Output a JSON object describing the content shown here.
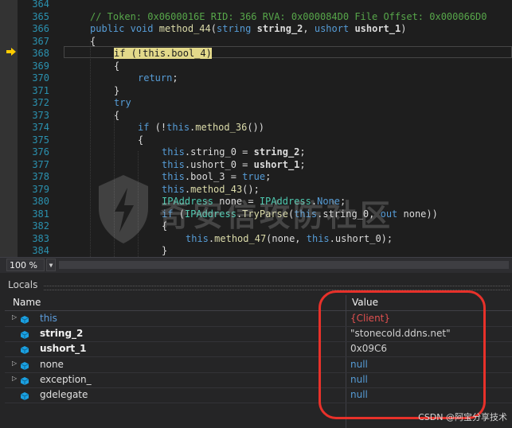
{
  "editor": {
    "lines": [
      {
        "n": "364",
        "parts": []
      },
      {
        "n": "365",
        "parts": [
          {
            "c": "cm",
            "t": "// Token: 0x0600016E RID: 366 RVA: 0x000084D0 File Offset: 0x000066D0"
          }
        ],
        "indent": 0
      },
      {
        "n": "366",
        "parts": [
          {
            "c": "kw",
            "t": "public"
          },
          {
            "c": "pl",
            "t": " "
          },
          {
            "c": "kw",
            "t": "void"
          },
          {
            "c": "pl",
            "t": " "
          },
          {
            "c": "fn",
            "t": "method_44"
          },
          {
            "c": "pl",
            "t": "("
          },
          {
            "c": "kw",
            "t": "string"
          },
          {
            "c": "pl",
            "t": " "
          },
          {
            "c": "bd",
            "t": "string_2"
          },
          {
            "c": "pl",
            "t": ", "
          },
          {
            "c": "kw",
            "t": "ushort"
          },
          {
            "c": "pl",
            "t": " "
          },
          {
            "c": "bd",
            "t": "ushort_1"
          },
          {
            "c": "pl",
            "t": ")"
          }
        ],
        "indent": 0
      },
      {
        "n": "367",
        "parts": [
          {
            "c": "pl",
            "t": "{"
          }
        ],
        "indent": 0
      },
      {
        "n": "368",
        "parts": [
          {
            "c": "kw hl",
            "t": "if"
          },
          {
            "c": "pl hl",
            "t": " (!"
          },
          {
            "c": "kw hl",
            "t": "this"
          },
          {
            "c": "pl hl",
            "t": ".bool_4)"
          }
        ],
        "indent": 1
      },
      {
        "n": "369",
        "parts": [
          {
            "c": "pl",
            "t": "{"
          }
        ],
        "indent": 1
      },
      {
        "n": "370",
        "parts": [
          {
            "c": "kw",
            "t": "return"
          },
          {
            "c": "pl",
            "t": ";"
          }
        ],
        "indent": 2
      },
      {
        "n": "371",
        "parts": [
          {
            "c": "pl",
            "t": "}"
          }
        ],
        "indent": 1
      },
      {
        "n": "372",
        "parts": [
          {
            "c": "kw",
            "t": "try"
          }
        ],
        "indent": 1
      },
      {
        "n": "373",
        "parts": [
          {
            "c": "pl",
            "t": "{"
          }
        ],
        "indent": 1
      },
      {
        "n": "374",
        "parts": [
          {
            "c": "kw",
            "t": "if"
          },
          {
            "c": "pl",
            "t": " (!"
          },
          {
            "c": "kw",
            "t": "this"
          },
          {
            "c": "pl",
            "t": "."
          },
          {
            "c": "fn",
            "t": "method_36"
          },
          {
            "c": "pl",
            "t": "())"
          }
        ],
        "indent": 2
      },
      {
        "n": "375",
        "parts": [
          {
            "c": "pl",
            "t": "{"
          }
        ],
        "indent": 2
      },
      {
        "n": "376",
        "parts": [
          {
            "c": "kw",
            "t": "this"
          },
          {
            "c": "pl",
            "t": ".string_0 = "
          },
          {
            "c": "bd",
            "t": "string_2"
          },
          {
            "c": "pl",
            "t": ";"
          }
        ],
        "indent": 3
      },
      {
        "n": "377",
        "parts": [
          {
            "c": "kw",
            "t": "this"
          },
          {
            "c": "pl",
            "t": ".ushort_0 = "
          },
          {
            "c": "bd",
            "t": "ushort_1"
          },
          {
            "c": "pl",
            "t": ";"
          }
        ],
        "indent": 3
      },
      {
        "n": "378",
        "parts": [
          {
            "c": "kw",
            "t": "this"
          },
          {
            "c": "pl",
            "t": ".bool_3 = "
          },
          {
            "c": "kw",
            "t": "true"
          },
          {
            "c": "pl",
            "t": ";"
          }
        ],
        "indent": 3
      },
      {
        "n": "379",
        "parts": [
          {
            "c": "kw",
            "t": "this"
          },
          {
            "c": "pl",
            "t": "."
          },
          {
            "c": "fn",
            "t": "method_43"
          },
          {
            "c": "pl",
            "t": "();"
          }
        ],
        "indent": 3
      },
      {
        "n": "380",
        "parts": [
          {
            "c": "ty",
            "t": "IPAddress"
          },
          {
            "c": "pl",
            "t": " none = "
          },
          {
            "c": "ty",
            "t": "IPAddress"
          },
          {
            "c": "pl",
            "t": "."
          },
          {
            "c": "kw",
            "t": "None"
          },
          {
            "c": "pl",
            "t": ";"
          }
        ],
        "indent": 3
      },
      {
        "n": "381",
        "parts": [
          {
            "c": "kw",
            "t": "if"
          },
          {
            "c": "pl",
            "t": " ("
          },
          {
            "c": "ty",
            "t": "IPAddress"
          },
          {
            "c": "pl",
            "t": "."
          },
          {
            "c": "fn",
            "t": "TryParse"
          },
          {
            "c": "pl",
            "t": "("
          },
          {
            "c": "kw",
            "t": "this"
          },
          {
            "c": "pl",
            "t": ".string_0, "
          },
          {
            "c": "kw",
            "t": "out"
          },
          {
            "c": "pl",
            "t": " none))"
          }
        ],
        "indent": 3
      },
      {
        "n": "382",
        "parts": [
          {
            "c": "pl",
            "t": "{"
          }
        ],
        "indent": 3
      },
      {
        "n": "383",
        "parts": [
          {
            "c": "kw",
            "t": "this"
          },
          {
            "c": "pl",
            "t": "."
          },
          {
            "c": "fn",
            "t": "method_47"
          },
          {
            "c": "pl",
            "t": "(none, "
          },
          {
            "c": "kw",
            "t": "this"
          },
          {
            "c": "pl",
            "t": ".ushort_0);"
          }
        ],
        "indent": 4
      },
      {
        "n": "384",
        "parts": [
          {
            "c": "pl",
            "t": "}"
          }
        ],
        "indent": 3
      }
    ]
  },
  "watermark": {
    "text": "奇安信攻防社区"
  },
  "zoom": {
    "value": "100 %"
  },
  "locals": {
    "title": "Locals",
    "columns": {
      "name": "Name",
      "value": "Value"
    },
    "rows": [
      {
        "name": "this",
        "value": "{Client}",
        "expandable": true,
        "name_style": "t",
        "value_style": "red"
      },
      {
        "name": "string_2",
        "value": "\"stonecold.ddns.net\"",
        "expandable": false,
        "name_style": "b",
        "value_style": ""
      },
      {
        "name": "ushort_1",
        "value": "0x09C6",
        "expandable": false,
        "name_style": "b",
        "value_style": ""
      },
      {
        "name": "none",
        "value": "null",
        "expandable": true,
        "name_style": "",
        "value_style": "blue"
      },
      {
        "name": "exception_",
        "value": "null",
        "expandable": true,
        "name_style": "",
        "value_style": "blue"
      },
      {
        "name": "gdelegate",
        "value": "null",
        "expandable": false,
        "name_style": "",
        "value_style": "blue"
      }
    ]
  },
  "credit": "CSDN @阿宝分享技术",
  "colors": {
    "keyword": "#569cd6",
    "comment": "#57a64a",
    "type": "#4ec9b0",
    "method": "#dcdcaa",
    "line_number": "#2b91af",
    "highlight": "#e3d98a",
    "annotation": "#e8312a",
    "null_value": "#569cd6",
    "object_value": "#e05050"
  }
}
